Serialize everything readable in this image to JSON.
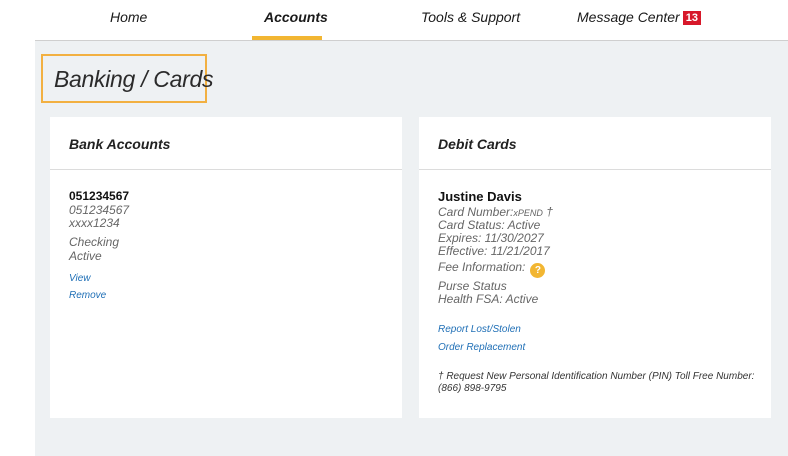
{
  "nav": {
    "items": [
      {
        "label": "Home"
      },
      {
        "label": "Accounts"
      },
      {
        "label": "Tools & Support"
      },
      {
        "label": "Message Center"
      }
    ],
    "message_count": "13"
  },
  "page": {
    "title": "Banking / Cards"
  },
  "bank_accounts": {
    "title": "Bank Accounts",
    "routing": "051234567",
    "routing_sub": "051234567",
    "masked_account": "xxxx1234",
    "type": "Checking",
    "status": "Active",
    "view_label": "View",
    "remove_label": "Remove"
  },
  "debit_cards": {
    "title": "Debit Cards",
    "holder": "Justine Davis",
    "card_number_label": "Card Number:",
    "card_number_value": "xPEND",
    "card_number_mark": "†",
    "card_status": "Card Status: Active",
    "expires": "Expires: 11/30/2027",
    "effective": "Effective: 11/21/2017",
    "fee_information": "Fee Information:",
    "fee_icon": "?",
    "purse_status": "Purse Status",
    "health_fsa": "Health FSA: Active",
    "report_lost_label": "Report Lost/Stolen",
    "order_replacement_label": "Order Replacement",
    "pin_note": "† Request New Personal Identification Number (PIN) Toll Free Number: (866) 898-9795"
  },
  "colors": {
    "accent": "#f2b632",
    "badge": "#d7182a",
    "link": "#1f6fb6",
    "background": "#eef1f3"
  }
}
